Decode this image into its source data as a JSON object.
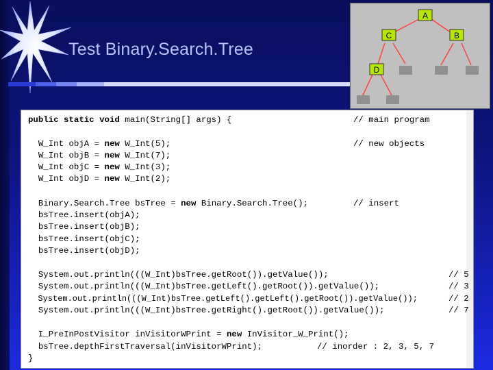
{
  "title": "Test Binary.Search.Tree",
  "tree": {
    "nodes": [
      {
        "label": "A",
        "color": "#b7e600"
      },
      {
        "label": "C",
        "color": "#b7e600"
      },
      {
        "label": "B",
        "color": "#b7e600"
      },
      {
        "label": "D",
        "color": "#b7e600"
      }
    ]
  },
  "code": {
    "lines": [
      {
        "pre": "",
        "kw": "public static void",
        "post": " main(String[] args) {",
        "comment": "// main program"
      },
      {
        "pre": "  W_Int objA = ",
        "kw": "new",
        "post": " W_Int(5);",
        "comment": "// new objects"
      },
      {
        "pre": "  W_Int objB = ",
        "kw": "new",
        "post": " W_Int(7);",
        "comment": ""
      },
      {
        "pre": "  W_Int objC = ",
        "kw": "new",
        "post": " W_Int(3);",
        "comment": ""
      },
      {
        "pre": "  W_Int objD = ",
        "kw": "new",
        "post": " W_Int(2);",
        "comment": ""
      },
      {
        "pre": "  Binary.Search.Tree bsTree = ",
        "kw": "new",
        "post": " Binary.Search.Tree();",
        "comment": "// insert"
      },
      {
        "pre": "  bsTree.insert(objA);",
        "kw": "",
        "post": "",
        "comment": ""
      },
      {
        "pre": "  bsTree.insert(objB);",
        "kw": "",
        "post": "",
        "comment": ""
      },
      {
        "pre": "  bsTree.insert(objC);",
        "kw": "",
        "post": "",
        "comment": ""
      },
      {
        "pre": "  bsTree.insert(objD);",
        "kw": "",
        "post": "",
        "comment": ""
      },
      {
        "pre": "  System.out.println(((W_Int)bsTree.getRoot()).getValue());",
        "kw": "",
        "post": "",
        "comment": "// 5"
      },
      {
        "pre": "  System.out.println(((W_Int)bsTree.getLeft().getRoot()).getValue());",
        "kw": "",
        "post": "",
        "comment": "// 3"
      },
      {
        "pre": "  System.out.println(((W_Int)bsTree.getLeft().getLeft().getRoot()).getValue());",
        "kw": "",
        "post": "",
        "comment": "// 2"
      },
      {
        "pre": "  System.out.println(((W_Int)bsTree.getRight().getRoot()).getValue());",
        "kw": "",
        "post": "",
        "comment": "// 7"
      },
      {
        "pre": "  I_PreInPostVisitor inVisitorWPrint = ",
        "kw": "new",
        "post": " InVisitor_W_Print();",
        "comment": ""
      },
      {
        "pre": "  bsTree.depthFirstTraversal(inVisitorWPrint);",
        "kw": "",
        "post": "",
        "comment": "// inorder : 2, 3, 5, 7"
      },
      {
        "pre": "}",
        "kw": "",
        "post": "",
        "comment": ""
      }
    ]
  }
}
